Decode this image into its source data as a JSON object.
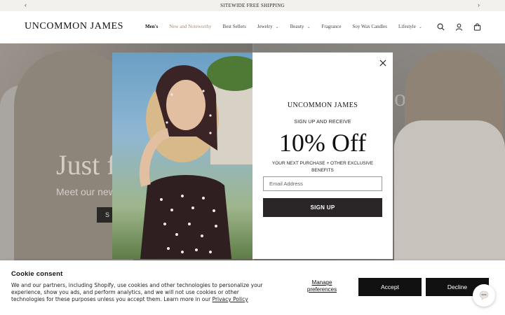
{
  "announcement": {
    "text": "SITEWIDE FREE SHIPPING"
  },
  "header": {
    "logo": "UNCOMMON JAMES",
    "nav": [
      {
        "label": "Men's"
      },
      {
        "label": "New and Noteworthy"
      },
      {
        "label": "Best Sellers"
      },
      {
        "label": "Jewelry"
      },
      {
        "label": "Beauty"
      },
      {
        "label": "Fragrance"
      },
      {
        "label": "Soy Wax Candles"
      },
      {
        "label": "Lifestyle"
      }
    ]
  },
  "hero": {
    "title": "Just f",
    "subtitle": "Meet our new",
    "button_label": "S",
    "ghost_text": "ot"
  },
  "popup": {
    "logo": "UNCOMMON JAMES",
    "kicker": "SIGN UP AND RECEIVE",
    "offer": "10% Off",
    "description": "YOUR NEXT PURCHASE + OTHER EXCLUSIVE BENEFITS",
    "email_placeholder": "Email Address",
    "signup_label": "SIGN UP"
  },
  "cookie": {
    "title": "Cookie consent",
    "text": "We and our partners, including Shopify, use cookies and other technologies to personalize your experience, show you ads, and perform analytics, and we will not use cookies or other technologies for these purposes unless you accept them. Learn more in our ",
    "policy_link": "Privacy Policy",
    "manage_label": "Manage preferences",
    "accept_label": "Accept",
    "decline_label": "Decline"
  }
}
